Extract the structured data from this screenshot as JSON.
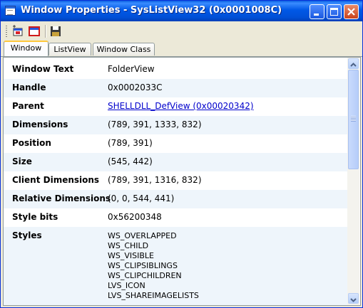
{
  "window": {
    "title": "Window Properties - SysListView32 (0x0001008C)",
    "colors": {
      "titlebar": "#0055e5",
      "link": "#0000cc",
      "alt_row": "#eef5fb",
      "tab_highlight": "#ffc83c"
    }
  },
  "titlebar_buttons": [
    "minimize-icon",
    "maximize-icon",
    "close-icon"
  ],
  "toolbar": {
    "icons": [
      "find-window-icon",
      "window-highlight-icon",
      "save-icon"
    ]
  },
  "tabs": [
    {
      "label": "Window",
      "active": true
    },
    {
      "label": "ListView",
      "active": false
    },
    {
      "label": "Window Class",
      "active": false
    }
  ],
  "properties": [
    {
      "key": "Window Text",
      "value": "FolderView"
    },
    {
      "key": "Handle",
      "value": "0x0002033C"
    },
    {
      "key": "Parent",
      "value": "SHELLDLL_DefView (0x00020342)"
    },
    {
      "key": "Dimensions",
      "value": "(789, 391, 1333, 832)"
    },
    {
      "key": "Position",
      "value": "(789, 391)"
    },
    {
      "key": "Size",
      "value": "(545, 442)"
    },
    {
      "key": "Client Dimensions",
      "value": "(789, 391, 1316, 832)"
    },
    {
      "key": "Relative Dimensions",
      "value": "(0, 0, 544, 441)"
    },
    {
      "key": "Style bits",
      "value": "0x56200348"
    },
    {
      "key": "Styles",
      "values": [
        "WS_OVERLAPPED",
        "WS_CHILD",
        "WS_VISIBLE",
        "WS_CLIPSIBLINGS",
        "WS_CLIPCHILDREN",
        "LVS_ICON",
        "LVS_SHAREIMAGELISTS"
      ]
    }
  ]
}
